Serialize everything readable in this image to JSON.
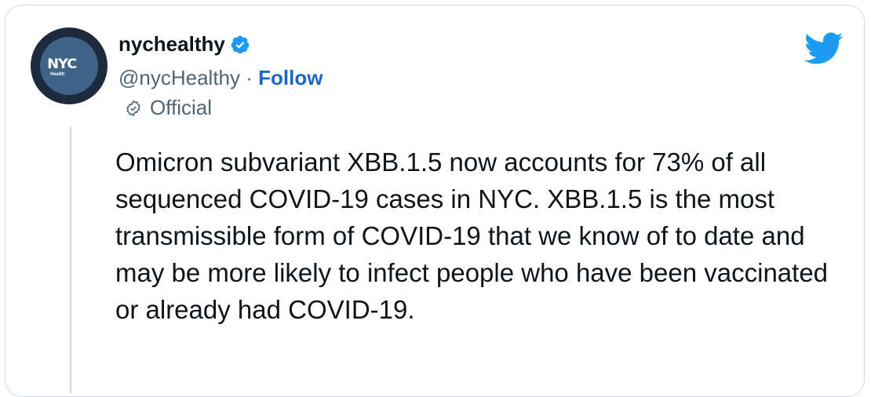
{
  "tweet": {
    "display_name": "nychealthy",
    "handle": "@nycHealthy",
    "separator": " · ",
    "follow_label": "Follow",
    "official_label": "Official",
    "avatar_logo": "NYC",
    "avatar_sub": "Health",
    "text": "Omicron subvariant XBB.1.5 now accounts for 73% of all sequenced COVID-19 cases in NYC. XBB.1.5 is the most transmissible form of COVID-19 that we know of to date and may be more likely to infect people who have been vaccinated or already had COVID-19."
  },
  "icons": {
    "verified": "verified-badge-icon",
    "official": "official-badge-icon",
    "brand": "twitter-bird-icon"
  },
  "colors": {
    "twitter_blue": "#1d9bf0",
    "follow_link": "#1b66c9",
    "avatar_ring": "#1d2b3c",
    "avatar_fill": "#3f6487"
  }
}
